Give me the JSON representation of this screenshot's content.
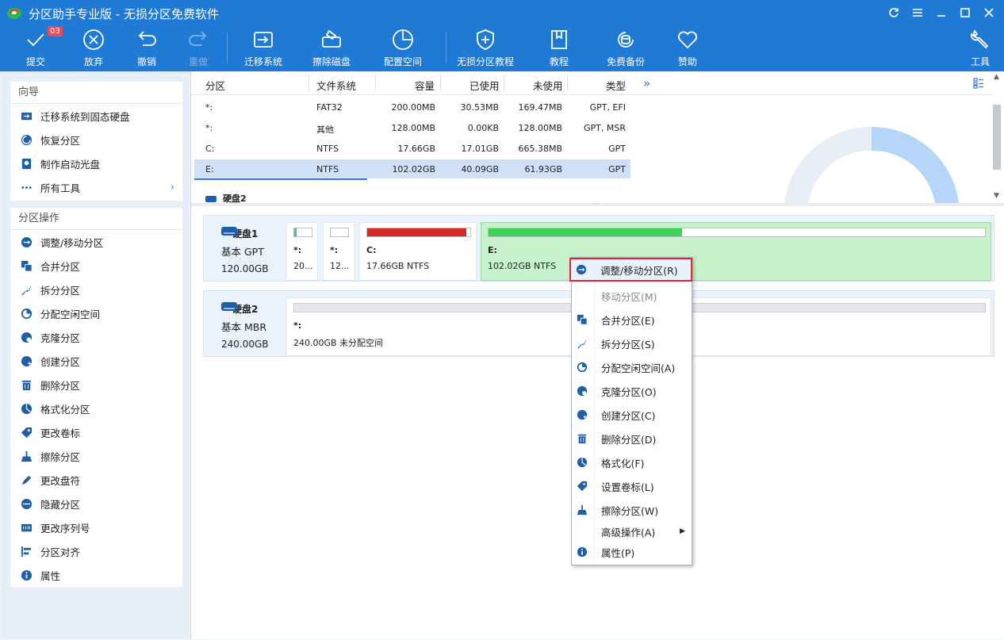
{
  "window": {
    "title": "分区助手专业版 - 无损分区免费软件"
  },
  "toolbar": {
    "commit": {
      "label": "提交",
      "badge": "03"
    },
    "discard": {
      "label": "放弃"
    },
    "undo": {
      "label": "撤销"
    },
    "redo": {
      "label": "重做"
    },
    "migrate": {
      "label": "迁移系统"
    },
    "wipe_disk": {
      "label": "擦除磁盘"
    },
    "allocate": {
      "label": "配置空间"
    },
    "tutorial_lossless": {
      "label": "无损分区教程"
    },
    "tutorial": {
      "label": "教程"
    },
    "backup": {
      "label": "免费备份"
    },
    "sponsor": {
      "label": "赞助"
    },
    "tools": {
      "label": "工具"
    }
  },
  "sidebar": {
    "wizard": {
      "title": "向导",
      "items": [
        {
          "label": "迁移系统到固态硬盘",
          "icon": "migrate-icon"
        },
        {
          "label": "恢复分区",
          "icon": "recover-icon"
        },
        {
          "label": "制作启动光盘",
          "icon": "bootdisk-icon"
        },
        {
          "label": "所有工具",
          "icon": "more-icon"
        }
      ]
    },
    "operations": {
      "title": "分区操作",
      "items": [
        {
          "label": "调整/移动分区",
          "icon": "resize-icon"
        },
        {
          "label": "合并分区",
          "icon": "merge-icon"
        },
        {
          "label": "拆分分区",
          "icon": "split-icon"
        },
        {
          "label": "分配空闲空间",
          "icon": "allocate-icon"
        },
        {
          "label": "克隆分区",
          "icon": "clone-icon"
        },
        {
          "label": "创建分区",
          "icon": "create-icon"
        },
        {
          "label": "删除分区",
          "icon": "delete-icon"
        },
        {
          "label": "格式化分区",
          "icon": "format-icon"
        },
        {
          "label": "更改卷标",
          "icon": "label-icon"
        },
        {
          "label": "擦除分区",
          "icon": "wipe-icon"
        },
        {
          "label": "更改盘符",
          "icon": "letter-icon"
        },
        {
          "label": "隐藏分区",
          "icon": "hide-icon"
        },
        {
          "label": "更改序列号",
          "icon": "serial-icon"
        },
        {
          "label": "分区对齐",
          "icon": "align-icon"
        },
        {
          "label": "属性",
          "icon": "info-icon"
        }
      ]
    }
  },
  "table": {
    "headers": [
      "分区",
      "文件系统",
      "容量",
      "已使用",
      "未使用",
      "类型"
    ],
    "rows": [
      [
        "*:",
        "FAT32",
        "200.00MB",
        "30.53MB",
        "169.47MB",
        "GPT, EFI"
      ],
      [
        "*:",
        "其他",
        "128.00MB",
        "0.00KB",
        "128.00MB",
        "GPT, MSR"
      ],
      [
        "C:",
        "NTFS",
        "17.66GB",
        "17.01GB",
        "665.38MB",
        "GPT"
      ],
      [
        "E:",
        "NTFS",
        "102.02GB",
        "40.09GB",
        "61.93GB",
        "GPT"
      ]
    ],
    "selected_row": 3,
    "disk2_peek": "硬盘2",
    "more_columns": "»"
  },
  "disks": [
    {
      "name": "硬盘1",
      "type": "基本 GPT",
      "size": "120.00GB",
      "partitions": [
        {
          "label": "*:",
          "desc": "20...",
          "used_fraction": 0.15,
          "color": "#3fcf5c"
        },
        {
          "label": "*:",
          "desc": "12...",
          "used_fraction": 0.0,
          "color": "#3fcf5c"
        },
        {
          "label": "C:",
          "desc": "17.66GB NTFS",
          "used_fraction": 0.96,
          "color": "#d42a2a"
        },
        {
          "label": "E:",
          "desc": "102.02GB NTFS",
          "used_fraction": 0.39,
          "color": "#3fcf5c"
        }
      ]
    },
    {
      "name": "硬盘2",
      "type": "基本 MBR",
      "size": "240.00GB",
      "partitions": [
        {
          "label": "*:",
          "desc": "240.00GB 未分配空间",
          "used_fraction": 0.0,
          "color": "#c9cfd6"
        }
      ]
    }
  ],
  "context_menu": {
    "items": [
      {
        "label": "调整/移动分区(R)",
        "icon": "resize-icon",
        "highlighted": true
      },
      {
        "label": "移动分区(M)",
        "icon": "",
        "disabled": true
      },
      {
        "label": "合并分区(E)",
        "icon": "merge-icon"
      },
      {
        "label": "拆分分区(S)",
        "icon": "split-icon"
      },
      {
        "label": "分配空闲空间(A)",
        "icon": "allocate-icon"
      },
      {
        "label": "克隆分区(O)",
        "icon": "clone-icon"
      },
      {
        "label": "创建分区(C)",
        "icon": "create-icon"
      },
      {
        "label": "删除分区(D)",
        "icon": "delete-icon"
      },
      {
        "label": "格式化(F)",
        "icon": "format-icon"
      },
      {
        "label": "设置卷标(L)",
        "icon": "label-icon"
      },
      {
        "label": "擦除分区(W)",
        "icon": "wipe-icon"
      },
      {
        "label": "高级操作(A)",
        "icon": "",
        "submenu": true
      },
      {
        "label": "属性(P)",
        "icon": "info-icon"
      }
    ]
  },
  "colors": {
    "accent": "#1f7ad6",
    "selected_row": "#cfe0f7",
    "used_green": "#3fcf5c",
    "used_red": "#d42a2a",
    "partition_selected": "#c6f2cc",
    "highlight_border": "#e0272e"
  }
}
